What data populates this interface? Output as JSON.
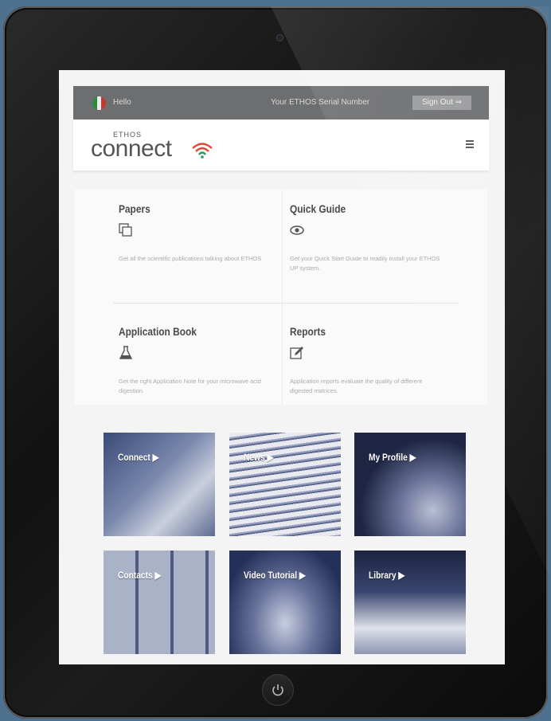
{
  "topbar": {
    "greeting": "Hello",
    "serial_label": "Your ETHOS Serial Number",
    "signout_label": "Sign Out"
  },
  "header": {
    "logo_small": "ETHOS",
    "logo_main": "connect"
  },
  "cards": [
    {
      "title": "Papers",
      "icon": "copy-icon",
      "desc": "Get all the scientific publications talking about ETHOS"
    },
    {
      "title": "Quick Guide",
      "icon": "eye-icon",
      "desc": "Get your Quick Start Guide to readily install your ETHOS UP system."
    },
    {
      "title": "Application Book",
      "icon": "flask-icon",
      "desc": "Get the right Application Note for your microwave acid digestion."
    },
    {
      "title": "Reports",
      "icon": "edit-icon",
      "desc": "Application reports evaluate the quality of different digested matrices."
    }
  ],
  "tiles": [
    {
      "label": "Connect"
    },
    {
      "label": "News"
    },
    {
      "label": "My Profile"
    },
    {
      "label": "Contacts"
    },
    {
      "label": "Video Tutorial"
    },
    {
      "label": "Library"
    }
  ],
  "colors": {
    "topbar": "#6d6e70",
    "tile_tint": "#2f3f6a",
    "signout": "#9a9b9d"
  }
}
